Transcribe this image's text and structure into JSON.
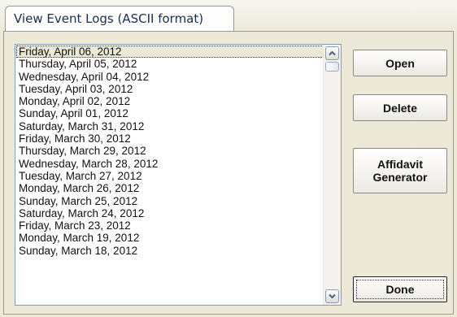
{
  "window": {
    "title": "View Event Logs (ASCII format)"
  },
  "log_list": {
    "items": [
      "Friday, April 06, 2012",
      "Thursday, April 05, 2012",
      "Wednesday, April 04, 2012",
      "Tuesday, April 03, 2012",
      "Monday, April 02, 2012",
      "Sunday, April 01, 2012",
      "Saturday, March 31, 2012",
      "Friday, March 30, 2012",
      "Thursday, March 29, 2012",
      "Wednesday, March 28, 2012",
      "Tuesday, March 27, 2012",
      "Monday, March 26, 2012",
      "Sunday, March 25, 2012",
      "Saturday, March 24, 2012",
      "Friday, March 23, 2012",
      "Monday, March 19, 2012",
      "Sunday, March 18, 2012"
    ],
    "selected_index": 0
  },
  "buttons": {
    "open": "Open",
    "delete": "Delete",
    "affidavit": "Affidavit\nGenerator",
    "done": "Done"
  },
  "icons": {
    "scroll_up": "chevron-up-icon",
    "scroll_down": "chevron-down-icon"
  },
  "colors": {
    "window_bg": "#ece9d8",
    "title_text": "#1a2d55",
    "list_border": "#7f9db9"
  }
}
